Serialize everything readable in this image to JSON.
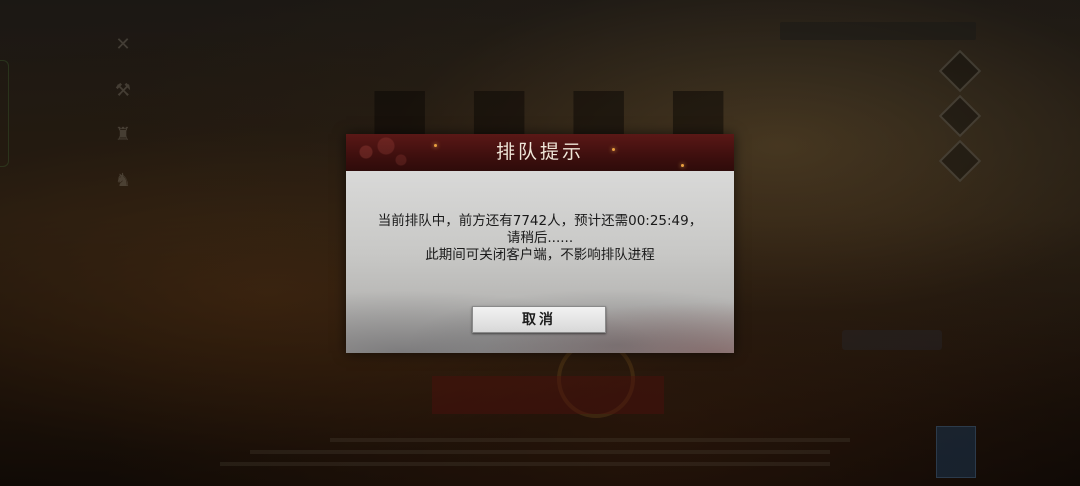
{
  "dialog": {
    "title": "排队提示",
    "message_line1": "当前排队中，前方还有7742人，预计还需00:25:49，",
    "message_line2": "请稍后......",
    "message_line3": "此期间可关闭客户端，不影响排队进程",
    "cancel_label": "取消"
  },
  "background": {
    "left_icons": [
      "crossed-swords-icon",
      "hammer-icon",
      "person-icon",
      "figure-icon"
    ],
    "right_icons": [
      "menu-diamond-icon",
      "settings-diamond-icon",
      "help-diamond-icon"
    ]
  }
}
